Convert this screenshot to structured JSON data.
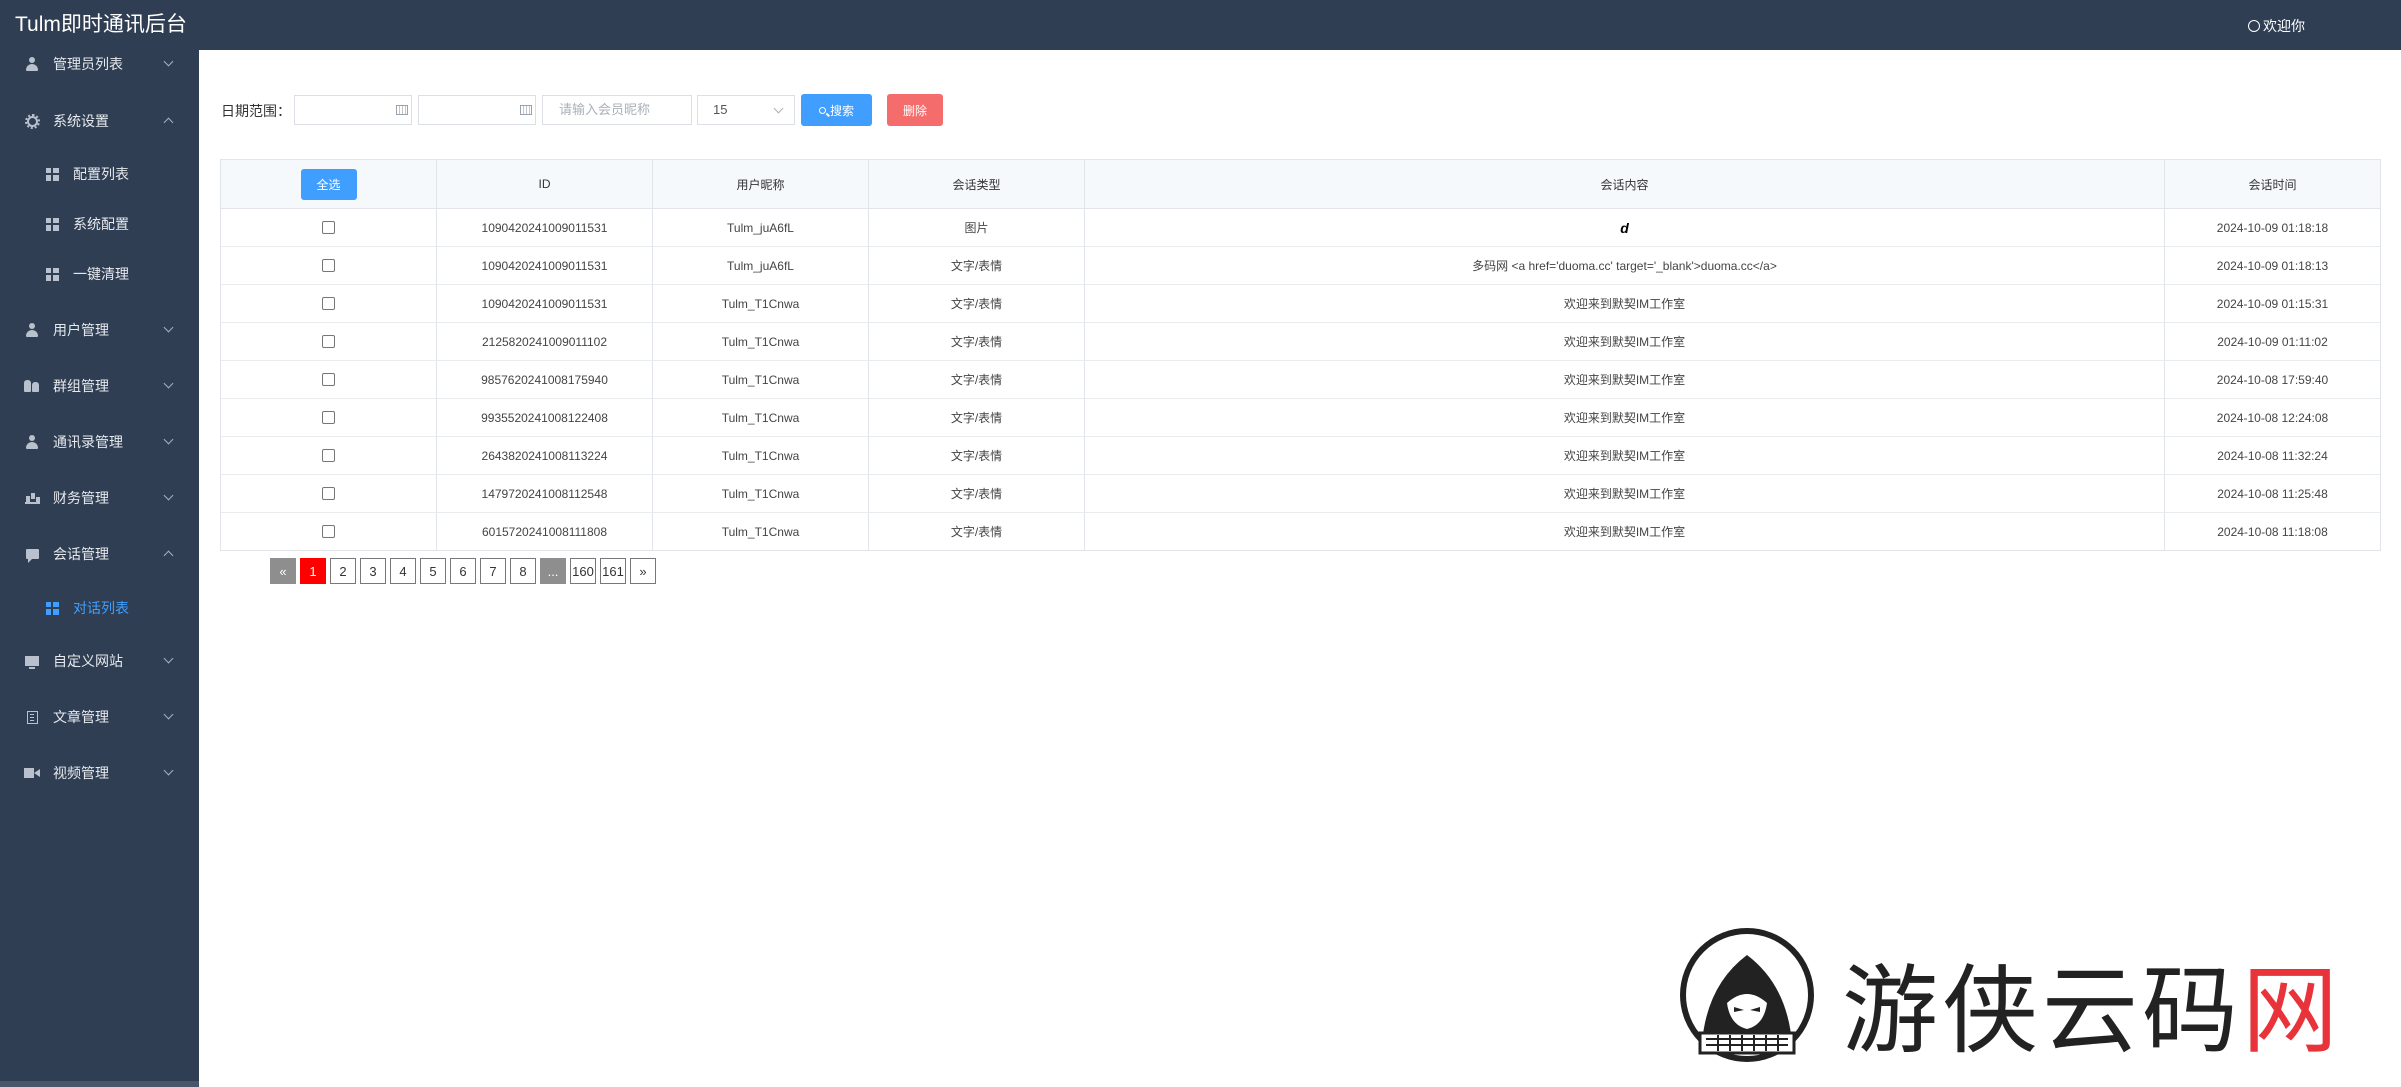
{
  "header": {
    "title": "Tulm即时通讯后台",
    "welcome": "欢迎你"
  },
  "sidebar": {
    "items": [
      {
        "label": "管理员列表",
        "icon": "person-icon",
        "expanded": false
      },
      {
        "label": "系统设置",
        "icon": "gear-icon",
        "expanded": true
      },
      {
        "label": "配置列表",
        "icon": "grid-icon",
        "sub": true
      },
      {
        "label": "系统配置",
        "icon": "grid-icon",
        "sub": true
      },
      {
        "label": "一键清理",
        "icon": "grid-icon",
        "sub": true
      },
      {
        "label": "用户管理",
        "icon": "person-icon",
        "expanded": false
      },
      {
        "label": "群组管理",
        "icon": "group-icon",
        "expanded": false
      },
      {
        "label": "通讯录管理",
        "icon": "person-icon",
        "expanded": false
      },
      {
        "label": "财务管理",
        "icon": "chart-icon",
        "expanded": false
      },
      {
        "label": "会话管理",
        "icon": "chat-icon",
        "expanded": true
      },
      {
        "label": "对话列表",
        "icon": "grid-icon",
        "sub": true,
        "active": true
      },
      {
        "label": "自定义网站",
        "icon": "monitor-icon",
        "expanded": false
      },
      {
        "label": "文章管理",
        "icon": "doc-icon",
        "expanded": false
      },
      {
        "label": "视频管理",
        "icon": "video-icon",
        "expanded": false
      }
    ]
  },
  "filter": {
    "date_label": "日期范围：",
    "start_date": "",
    "end_date": "",
    "nickname_placeholder": "请输入会员昵称",
    "page_size": "15",
    "search_label": "搜索",
    "delete_label": "删除"
  },
  "table": {
    "select_all_label": "全选",
    "columns": [
      "ID",
      "用户昵称",
      "会话类型",
      "会话内容",
      "会话时间"
    ],
    "rows": [
      {
        "id": "1090420241009011531",
        "nickname": "Tulm_juA6fL",
        "type": "图片",
        "content": "d",
        "time": "2024-10-09 01:18:18"
      },
      {
        "id": "1090420241009011531",
        "nickname": "Tulm_juA6fL",
        "type": "文字/表情",
        "content": "多码网 <a href='duoma.cc' target='_blank'>duoma.cc</a>",
        "time": "2024-10-09 01:18:13"
      },
      {
        "id": "1090420241009011531",
        "nickname": "Tulm_T1Cnwa",
        "type": "文字/表情",
        "content": "欢迎来到默契IM工作室",
        "time": "2024-10-09 01:15:31"
      },
      {
        "id": "2125820241009011102",
        "nickname": "Tulm_T1Cnwa",
        "type": "文字/表情",
        "content": "欢迎来到默契IM工作室",
        "time": "2024-10-09 01:11:02"
      },
      {
        "id": "9857620241008175940",
        "nickname": "Tulm_T1Cnwa",
        "type": "文字/表情",
        "content": "欢迎来到默契IM工作室",
        "time": "2024-10-08 17:59:40"
      },
      {
        "id": "9935520241008122408",
        "nickname": "Tulm_T1Cnwa",
        "type": "文字/表情",
        "content": "欢迎来到默契IM工作室",
        "time": "2024-10-08 12:24:08"
      },
      {
        "id": "2643820241008113224",
        "nickname": "Tulm_T1Cnwa",
        "type": "文字/表情",
        "content": "欢迎来到默契IM工作室",
        "time": "2024-10-08 11:32:24"
      },
      {
        "id": "1479720241008112548",
        "nickname": "Tulm_T1Cnwa",
        "type": "文字/表情",
        "content": "欢迎来到默契IM工作室",
        "time": "2024-10-08 11:25:48"
      },
      {
        "id": "6015720241008111808",
        "nickname": "Tulm_T1Cnwa",
        "type": "文字/表情",
        "content": "欢迎来到默契IM工作室",
        "time": "2024-10-08 11:18:08"
      }
    ]
  },
  "pagination": {
    "prev": "«",
    "pages": [
      "1",
      "2",
      "3",
      "4",
      "5",
      "6",
      "7",
      "8",
      "...",
      "160",
      "161"
    ],
    "current": "1",
    "next": "»"
  },
  "watermark": {
    "text_main": "游侠云码",
    "text_accent": "网"
  }
}
